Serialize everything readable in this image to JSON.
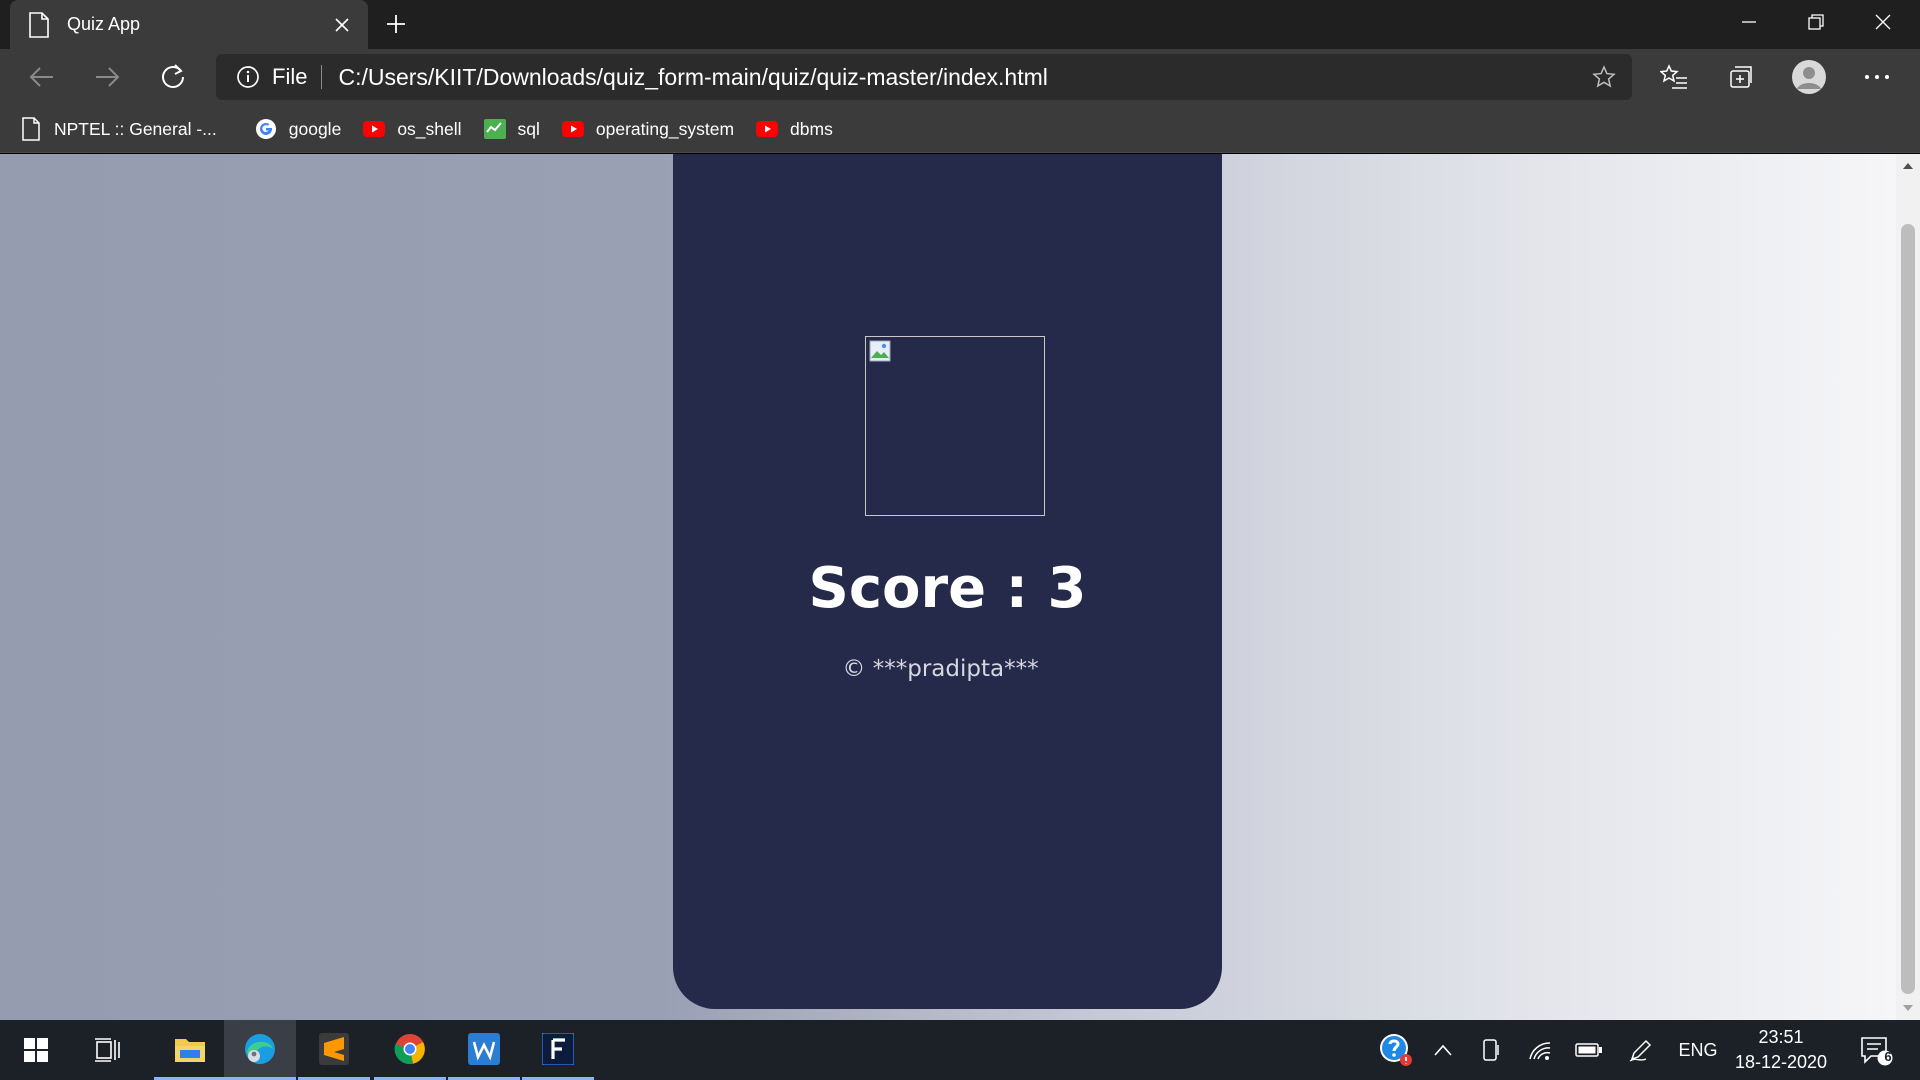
{
  "browser": {
    "tab": {
      "title": "Quiz App"
    },
    "address": {
      "scheme_label": "File",
      "url": "C:/Users/KIIT/Downloads/quiz_form-main/quiz/quiz-master/index.html"
    },
    "favorites": [
      {
        "label": "NPTEL :: General -...",
        "icon": "document-icon"
      },
      {
        "label": "google",
        "icon": "google-icon"
      },
      {
        "label": "os_shell",
        "icon": "youtube-icon"
      },
      {
        "label": "sql",
        "icon": "sheet-icon"
      },
      {
        "label": "operating_system",
        "icon": "youtube-icon"
      },
      {
        "label": "dbms",
        "icon": "youtube-icon"
      }
    ]
  },
  "page": {
    "score_label": "Score : ",
    "score_value": "3",
    "copyright": "© ***pradipta***"
  },
  "taskbar": {
    "language": "ENG",
    "time": "23:51",
    "date": "18-12-2020",
    "notification_count": "6",
    "apps": [
      "start-icon",
      "task-view-icon",
      "file-explorer-icon",
      "edge-icon",
      "sublime-text-icon",
      "chrome-icon",
      "word-icon",
      "f-app-icon"
    ]
  },
  "colors": {
    "card": "#252a4a",
    "chrome_dark": "#1f1f1f",
    "chrome_mid": "#3b3b3b",
    "taskbar": "#1c2128"
  }
}
